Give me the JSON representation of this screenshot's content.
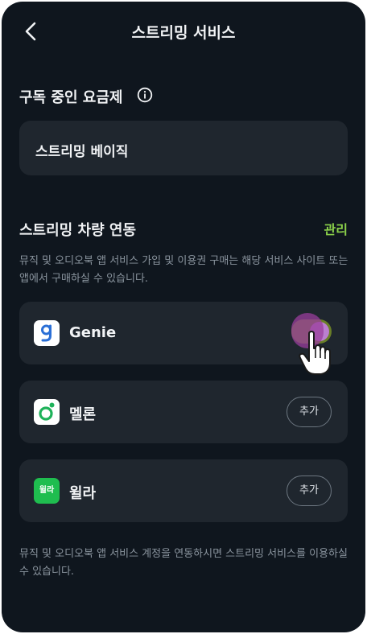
{
  "header": {
    "title": "스트리밍 서비스",
    "back_icon": "chevron-left-icon"
  },
  "subscription": {
    "title": "구독 중인 요금제",
    "info_icon": "info-icon",
    "plan": "스트리밍 베이직"
  },
  "linking": {
    "title": "스트리밍 차량 연동",
    "manage_label": "관리",
    "description": "뮤직 및 오디오북 앱 서비스 가입 및 이용권 구매는 해당 서비스 사이트 또는 앱에서 구매하실 수 있습니다.",
    "services": [
      {
        "name": "Genie",
        "icon": "genie-logo",
        "state": "toggle-on"
      },
      {
        "name": "멜론",
        "icon": "melon-logo",
        "action": "추가"
      },
      {
        "name": "윌라",
        "icon": "welaaa-logo",
        "icon_text": "윌라",
        "action": "추가"
      }
    ],
    "footer": "뮤직 및 오디오북 앱 서비스 계정을 연동하시면 스트리밍 서비스를 이용하실 수 있습니다."
  },
  "colors": {
    "background": "#0f161e",
    "card": "#1f262e",
    "accent": "#8bd14a",
    "toggle_track": "#6a7f27"
  }
}
